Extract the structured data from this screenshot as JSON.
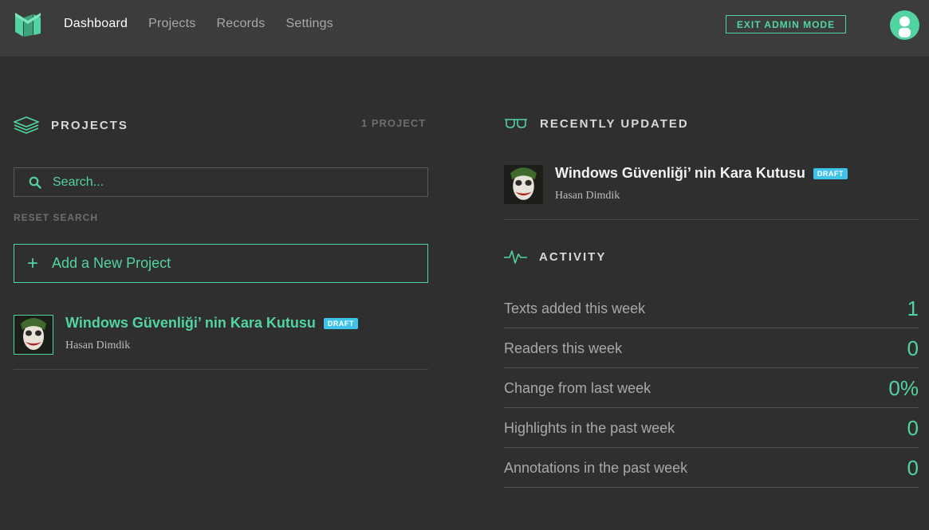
{
  "nav": {
    "items": [
      {
        "label": "Dashboard",
        "active": true
      },
      {
        "label": "Projects",
        "active": false
      },
      {
        "label": "Records",
        "active": false
      },
      {
        "label": "Settings",
        "active": false
      }
    ],
    "exit_admin_label": "EXIT ADMIN MODE"
  },
  "projects": {
    "heading": "PROJECTS",
    "count": "1 PROJECT",
    "search_placeholder": "Search...",
    "reset_label": "RESET SEARCH",
    "add_label": "Add a New Project",
    "items": [
      {
        "title": "Windows Güvenliği’ nin Kara Kutusu",
        "badge": "DRAFT",
        "author": "Hasan Dimdik"
      }
    ]
  },
  "recent": {
    "heading": "RECENTLY UPDATED",
    "items": [
      {
        "title": "Windows Güvenliği’ nin Kara Kutusu",
        "badge": "DRAFT",
        "author": "Hasan Dimdik"
      }
    ]
  },
  "activity": {
    "heading": "ACTIVITY",
    "rows": [
      {
        "label": "Texts added this week",
        "value": "1"
      },
      {
        "label": "Readers this week",
        "value": "0"
      },
      {
        "label": "Change from last week",
        "value": "0%"
      },
      {
        "label": "Highlights in the past week",
        "value": "0"
      },
      {
        "label": "Annotations in the past week",
        "value": "0"
      }
    ]
  },
  "colors": {
    "accent": "#52d4a0",
    "draft_badge": "#3fc3e8",
    "background": "#2f2f2f",
    "header": "#3c3c3c"
  },
  "icons": [
    "logo-icon",
    "layers-icon",
    "search-icon",
    "plus-icon",
    "glasses-icon",
    "pulse-icon",
    "user-avatar-icon"
  ]
}
